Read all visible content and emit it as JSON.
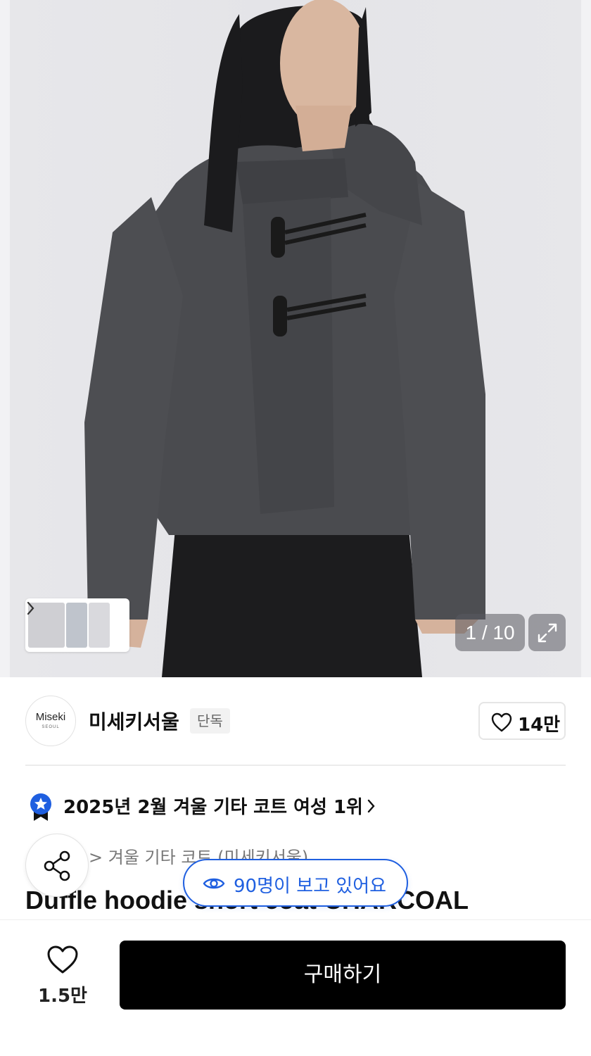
{
  "gallery": {
    "counter": "1 / 10",
    "icons": {
      "expand": "expand-icon",
      "thumb_next": "chevron-right-icon"
    }
  },
  "brand": {
    "logo_text": "Miseki",
    "logo_subtext": "SEOUL",
    "name": "미세키서울",
    "badge": "단독",
    "likes": "14만"
  },
  "ranking": {
    "text": "2025년 2월 겨울 기타 코트 여성 1위",
    "icon": "rank-badge-icon"
  },
  "breadcrumb": {
    "text": "> 겨울 기타 코트 (미세키서울)"
  },
  "viewers": {
    "text": "90명이 보고 있어요"
  },
  "product": {
    "title": "Duffle hoodie short coat CHARCOAL"
  },
  "bottom_bar": {
    "wish_count": "1.5만",
    "buy_label": "구매하기"
  },
  "colors": {
    "accent_blue": "#1f5fe0",
    "buy_button": "#000000",
    "coat": "#4a4b4f"
  }
}
